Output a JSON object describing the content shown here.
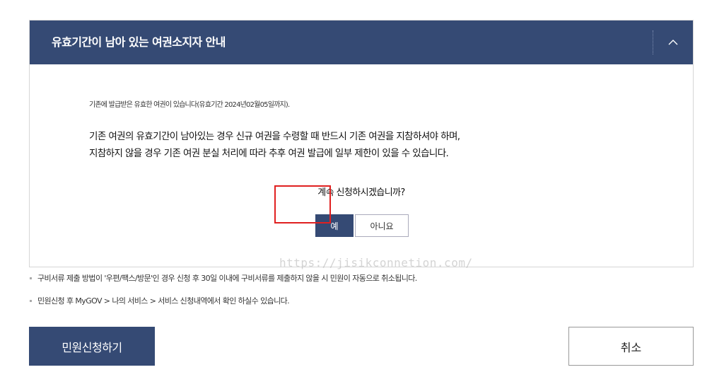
{
  "panel": {
    "title": "유효기간이 남아 있는 여권소지자 안내",
    "collapse_icon": "chevron-up-icon",
    "small_note": "기존에 발급받은 유효한 여권이 있습니다(유효기간 2024년02월05일까지).",
    "message_line1": "기존 여권의 유효기간이 남아있는 경우 신규 여권을 수령할 때 반드시 기존 여권을 지참하셔야 하며,",
    "message_line2": "지참하지 않을 경우 기존 여권 분실 처리에 따라 추후 여권 발급에 일부 제한이 있을 수 있습니다.",
    "question": "계속 신청하시겠습니까?",
    "yes_label": "예",
    "no_label": "아니요"
  },
  "watermark": "https://jisikconnetion.com/",
  "notices": [
    "구비서류 제출 방법이 '우편/팩스/방문'인 경우 신청 후 30일 이내에 구비서류를 제출하지 않을 시 민원이 자동으로 취소됩니다.",
    "민원신청 후 MyGOV > 나의 서비스 > 서비스 신청내역에서 확인 하실수 있습니다."
  ],
  "actions": {
    "apply_label": "민원신청하기",
    "cancel_label": "취소"
  },
  "colors": {
    "primary": "#354a74",
    "highlight": "#e02020"
  }
}
